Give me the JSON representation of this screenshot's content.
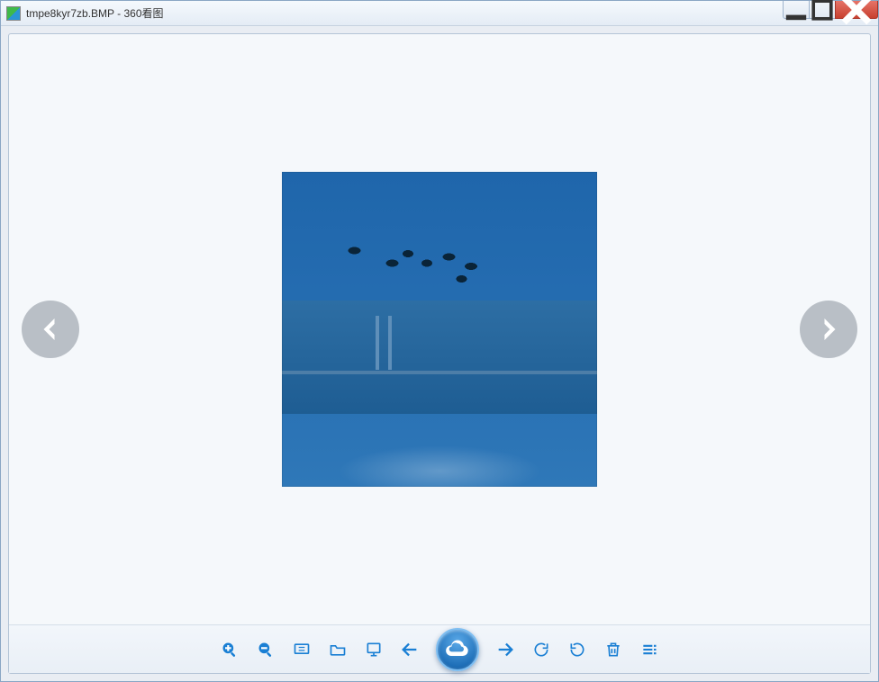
{
  "window": {
    "filename": "tmpe8kyr7zb.BMP",
    "separator": " - ",
    "app_name": "360看图"
  },
  "nav": {
    "prev_label": "Previous image",
    "next_label": "Next image"
  },
  "toolbar": {
    "zoom_in": "放大",
    "zoom_out": "缩小",
    "fit": "适应窗口",
    "open": "打开",
    "slideshow": "幻灯片",
    "prev": "上一张",
    "cloud": "云",
    "next": "下一张",
    "rotate_cw": "顺时针旋转",
    "rotate_ccw": "逆时针旋转",
    "delete": "删除",
    "more": "更多"
  },
  "win_controls": {
    "minimize": "最小化",
    "maximize": "最大化",
    "close": "关闭"
  },
  "colors": {
    "accent": "#1a7fd4",
    "window_border": "#8aa6c4",
    "close_red": "#c8402f"
  }
}
